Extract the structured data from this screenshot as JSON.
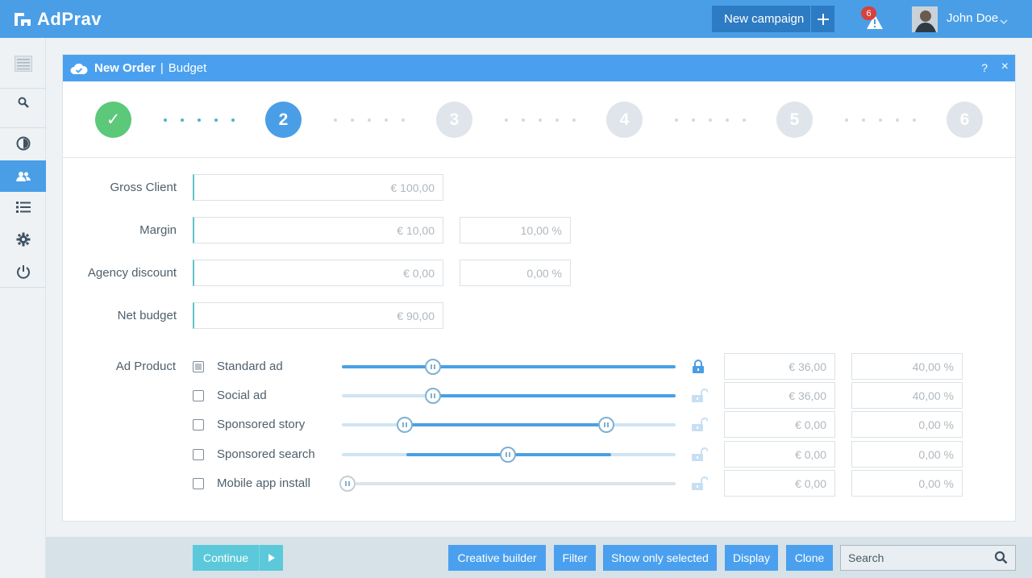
{
  "app": {
    "logo_text": "AdPrav"
  },
  "header": {
    "new_campaign_label": "New campaign",
    "alerts_count": "6",
    "user_name": "John Doe"
  },
  "sidebar": {
    "items": [
      {
        "icon": "menu-icon"
      },
      {
        "icon": "search-icon"
      },
      {
        "icon": "pie-chart-icon"
      },
      {
        "icon": "users-icon",
        "active": true
      },
      {
        "icon": "list-icon"
      },
      {
        "icon": "gear-icon"
      },
      {
        "icon": "power-icon"
      }
    ]
  },
  "panel": {
    "title": "New Order",
    "separator": "|",
    "subtitle": "Budget",
    "help": "?",
    "close": "×"
  },
  "steps": [
    "✓",
    "2",
    "3",
    "4",
    "5",
    "6"
  ],
  "form": {
    "gross_client": {
      "label": "Gross Client",
      "value": "€ 100,00"
    },
    "margin": {
      "label": "Margin",
      "value": "€ 10,00",
      "percent": "10,00 %"
    },
    "agency_discount": {
      "label": "Agency discount",
      "value": "€ 0,00",
      "percent": "0,00 %"
    },
    "net_budget": {
      "label": "Net budget",
      "value": "€ 90,00"
    }
  },
  "ad_products": {
    "label": "Ad Product",
    "items": [
      {
        "name": "Standard ad",
        "checked": true,
        "locked": true,
        "amount": "€ 36,00",
        "percent": "40,00 %"
      },
      {
        "name": "Social ad",
        "checked": false,
        "locked": false,
        "amount": "€ 36,00",
        "percent": "40,00 %"
      },
      {
        "name": "Sponsored story",
        "checked": false,
        "locked": false,
        "amount": "€ 0,00",
        "percent": "0,00 %"
      },
      {
        "name": "Sponsored search",
        "checked": false,
        "locked": false,
        "amount": "€ 0,00",
        "percent": "0,00 %"
      },
      {
        "name": "Mobile app install",
        "checked": false,
        "locked": false,
        "amount": "€ 0,00",
        "percent": "0,00 %"
      }
    ]
  },
  "footer": {
    "continue_label": "Continue",
    "buttons": {
      "creative_builder": "Creative builder",
      "filter": "Filter",
      "show_only_selected": "Show only selected",
      "display": "Display",
      "clone": "Clone"
    },
    "search_placeholder": "Search"
  },
  "colors": {
    "brand_blue": "#4a9ee6",
    "success_green": "#5cc87a",
    "teal": "#5bc9da",
    "alert_red": "#d6423d"
  }
}
